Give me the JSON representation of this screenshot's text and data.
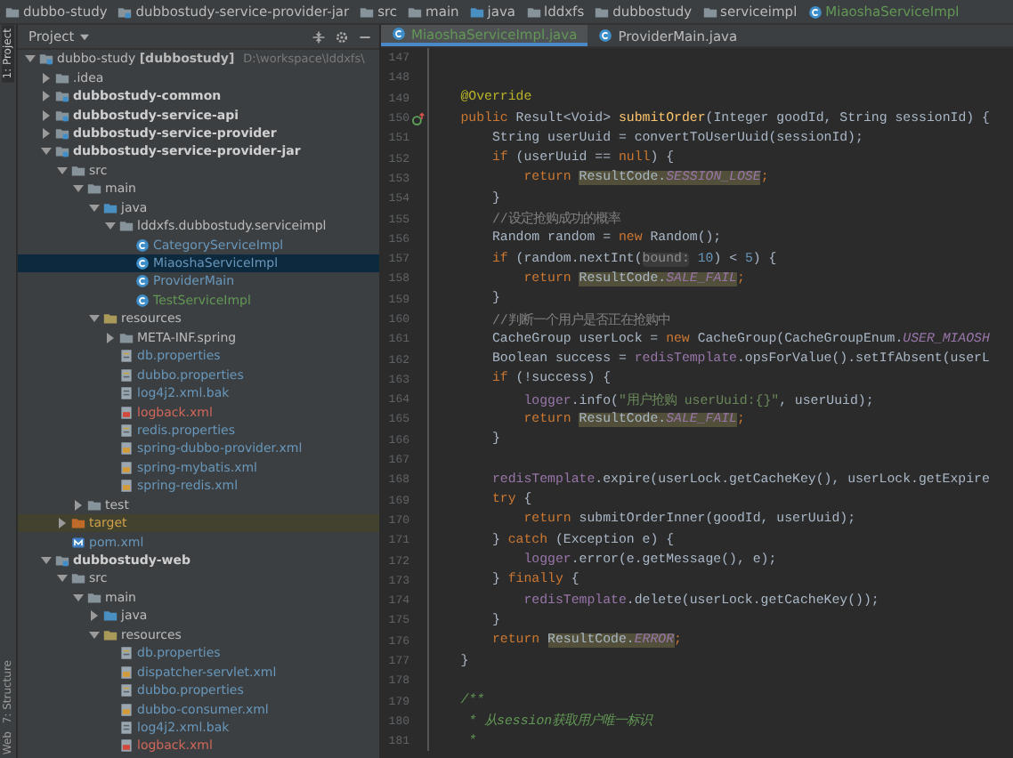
{
  "breadcrumbs": [
    {
      "label": "dubbo-study",
      "kind": "folder"
    },
    {
      "label": "dubbostudy-service-provider-jar",
      "kind": "module"
    },
    {
      "label": "src",
      "kind": "folder"
    },
    {
      "label": "main",
      "kind": "folder"
    },
    {
      "label": "java",
      "kind": "source"
    },
    {
      "label": "lddxfs",
      "kind": "folder"
    },
    {
      "label": "dubbostudy",
      "kind": "folder"
    },
    {
      "label": "serviceimpl",
      "kind": "folder"
    },
    {
      "label": "MiaoshaServiceImpl",
      "kind": "class",
      "color": "#629755"
    }
  ],
  "side_strip": [
    {
      "label": "1: Project",
      "selected": true
    },
    {
      "label": "7: Structure",
      "selected": false
    },
    {
      "label": "Web",
      "selected": false
    }
  ],
  "project_panel": {
    "title": "Project",
    "tree": [
      {
        "label": "dubbo-study **[dubbostudy]**",
        "path": "D:\\workspace\\lddxfs\\",
        "kind": "module",
        "expanded": true,
        "selected": false,
        "children": [
          {
            "label": ".idea",
            "kind": "folder",
            "expanded": false,
            "selected": false
          },
          {
            "label": "dubbostudy-common",
            "kind": "module",
            "expanded": false,
            "selected": false
          },
          {
            "label": "dubbostudy-service-api",
            "kind": "module",
            "expanded": false,
            "selected": false
          },
          {
            "label": "dubbostudy-service-provider",
            "kind": "module",
            "expanded": false,
            "selected": false
          },
          {
            "label": "dubbostudy-service-provider-jar",
            "kind": "module",
            "expanded": true,
            "selected": false,
            "children": [
              {
                "label": "src",
                "kind": "folder",
                "expanded": true,
                "selected": false,
                "children": [
                  {
                    "label": "main",
                    "kind": "folder",
                    "expanded": true,
                    "selected": false,
                    "children": [
                      {
                        "label": "java",
                        "kind": "source",
                        "expanded": true,
                        "selected": false,
                        "children": [
                          {
                            "label": "lddxfs.dubbostudy.serviceimpl",
                            "kind": "package",
                            "expanded": true,
                            "selected": false,
                            "children": [
                              {
                                "label": "CategoryServiceImpl",
                                "kind": "class",
                                "color": "#6897bb",
                                "selected": false
                              },
                              {
                                "label": "MiaoshaServiceImpl",
                                "kind": "class",
                                "color": "#6897bb",
                                "selected": true
                              },
                              {
                                "label": "ProviderMain",
                                "kind": "class",
                                "color": "#6897bb",
                                "selected": false
                              },
                              {
                                "label": "TestServiceImpl",
                                "kind": "class",
                                "color": "#629755",
                                "selected": false
                              }
                            ]
                          }
                        ]
                      },
                      {
                        "label": "resources",
                        "kind": "resources",
                        "expanded": true,
                        "selected": false,
                        "children": [
                          {
                            "label": "META-INF.spring",
                            "kind": "folder",
                            "expanded": false,
                            "selected": false
                          },
                          {
                            "label": "db.properties",
                            "kind": "properties",
                            "color": "#6897bb",
                            "selected": false
                          },
                          {
                            "label": "dubbo.properties",
                            "kind": "properties",
                            "color": "#6897bb",
                            "selected": false
                          },
                          {
                            "label": "log4j2.xml.bak",
                            "kind": "text",
                            "color": "#6897bb",
                            "selected": false
                          },
                          {
                            "label": "logback.xml",
                            "kind": "xml-red",
                            "color": "#d1675a",
                            "selected": false
                          },
                          {
                            "label": "redis.properties",
                            "kind": "properties",
                            "color": "#6897bb",
                            "selected": false
                          },
                          {
                            "label": "spring-dubbo-provider.xml",
                            "kind": "xml",
                            "color": "#6897bb",
                            "selected": false
                          },
                          {
                            "label": "spring-mybatis.xml",
                            "kind": "xml",
                            "color": "#6897bb",
                            "selected": false
                          },
                          {
                            "label": "spring-redis.xml",
                            "kind": "xml",
                            "color": "#6897bb",
                            "selected": false
                          }
                        ]
                      }
                    ]
                  },
                  {
                    "label": "test",
                    "kind": "folder",
                    "expanded": false,
                    "selected": false
                  }
                ]
              },
              {
                "label": "target",
                "kind": "excluded",
                "color": "#d0a14a",
                "expanded": false,
                "selected": false
              },
              {
                "label": "pom.xml",
                "kind": "pom",
                "color": "#6897bb",
                "selected": false
              }
            ]
          },
          {
            "label": "dubbostudy-web",
            "kind": "module",
            "expanded": true,
            "selected": false,
            "children": [
              {
                "label": "src",
                "kind": "folder",
                "expanded": true,
                "selected": false,
                "children": [
                  {
                    "label": "main",
                    "kind": "folder",
                    "expanded": true,
                    "selected": false,
                    "children": [
                      {
                        "label": "java",
                        "kind": "source",
                        "expanded": false,
                        "selected": false
                      },
                      {
                        "label": "resources",
                        "kind": "resources",
                        "expanded": true,
                        "selected": false,
                        "children": [
                          {
                            "label": "db.properties",
                            "kind": "properties",
                            "color": "#6897bb",
                            "selected": false
                          },
                          {
                            "label": "dispatcher-servlet.xml",
                            "kind": "xml",
                            "color": "#6897bb",
                            "selected": false
                          },
                          {
                            "label": "dubbo.properties",
                            "kind": "properties",
                            "color": "#6897bb",
                            "selected": false
                          },
                          {
                            "label": "dubbo-consumer.xml",
                            "kind": "xml",
                            "color": "#6897bb",
                            "selected": false
                          },
                          {
                            "label": "log4j2.xml.bak",
                            "kind": "text",
                            "color": "#6897bb",
                            "selected": false
                          },
                          {
                            "label": "logback.xml",
                            "kind": "xml-red",
                            "color": "#d1675a",
                            "selected": false
                          }
                        ]
                      }
                    ]
                  }
                ]
              }
            ]
          }
        ]
      }
    ]
  },
  "tabs": [
    {
      "label": "MiaoshaServiceImpl.java",
      "color": "#629755",
      "selected": true
    },
    {
      "label": "ProviderMain.java",
      "selected": false
    }
  ],
  "editor": {
    "lines": [
      {
        "number": "147"
      },
      {
        "number": "148"
      },
      {
        "number": "149",
        "tokens": [
          {
            "text": "    @Override",
            "kind": "annotation"
          }
        ]
      },
      {
        "number": "150",
        "overrides": true,
        "tokens": [
          {
            "text": "    public ",
            "kind": "keyword"
          },
          {
            "text": "Result<Void> ",
            "kind": "plain"
          },
          {
            "text": "submitOrder",
            "kind": "method"
          },
          {
            "text": "(Integer goodId, String sessionId) {",
            "kind": "plain"
          }
        ]
      },
      {
        "number": "151",
        "tokens": [
          {
            "text": "        String userUuid = convertToUserUuid(sessionId);",
            "kind": "plain"
          }
        ]
      },
      {
        "number": "152",
        "tokens": [
          {
            "text": "        if ",
            "kind": "keyword"
          },
          {
            "text": "(userUuid == ",
            "kind": "plain"
          },
          {
            "text": "null",
            "kind": "keyword"
          },
          {
            "text": ") {",
            "kind": "plain"
          }
        ]
      },
      {
        "number": "153",
        "tokens": [
          {
            "text": "            return ",
            "kind": "keyword"
          },
          {
            "text": "ResultCode.",
            "kind": "match"
          },
          {
            "text": "SESSION_LOSE",
            "kind": "match-static"
          },
          {
            "text": ";",
            "kind": "keyword"
          }
        ]
      },
      {
        "number": "154",
        "tokens": [
          {
            "text": "        }",
            "kind": "plain"
          }
        ]
      },
      {
        "number": "155",
        "tokens": [
          {
            "text": "        //设定抢购成功的概率",
            "kind": "comment"
          }
        ]
      },
      {
        "number": "156",
        "tokens": [
          {
            "text": "        Random random = ",
            "kind": "plain"
          },
          {
            "text": "new ",
            "kind": "keyword"
          },
          {
            "text": "Random();",
            "kind": "plain"
          }
        ]
      },
      {
        "number": "157",
        "tokens": [
          {
            "text": "        if ",
            "kind": "keyword"
          },
          {
            "text": "(random.nextInt(",
            "kind": "plain"
          },
          {
            "text": "bound:",
            "kind": "hint"
          },
          {
            "text": " 10",
            "kind": "number"
          },
          {
            "text": ") < ",
            "kind": "plain"
          },
          {
            "text": "5",
            "kind": "number"
          },
          {
            "text": ") {",
            "kind": "plain"
          }
        ]
      },
      {
        "number": "158",
        "tokens": [
          {
            "text": "            return ",
            "kind": "keyword"
          },
          {
            "text": "ResultCode.",
            "kind": "match"
          },
          {
            "text": "SALE_FAIL",
            "kind": "match-static"
          },
          {
            "text": ";",
            "kind": "keyword"
          }
        ]
      },
      {
        "number": "159",
        "tokens": [
          {
            "text": "        }",
            "kind": "plain"
          }
        ]
      },
      {
        "number": "160",
        "tokens": [
          {
            "text": "        //判断一个用户是否正在抢购中",
            "kind": "comment"
          }
        ]
      },
      {
        "number": "161",
        "tokens": [
          {
            "text": "        CacheGroup userLock = ",
            "kind": "plain"
          },
          {
            "text": "new ",
            "kind": "keyword"
          },
          {
            "text": "CacheGroup(CacheGroupEnum.",
            "kind": "plain"
          },
          {
            "text": "USER_MIAOSH",
            "kind": "static"
          }
        ]
      },
      {
        "number": "162",
        "tokens": [
          {
            "text": "        Boolean success = ",
            "kind": "plain"
          },
          {
            "text": "redisTemplate",
            "kind": "field"
          },
          {
            "text": ".opsForValue().setIfAbsent(userL",
            "kind": "plain"
          }
        ]
      },
      {
        "number": "163",
        "tokens": [
          {
            "text": "        if ",
            "kind": "keyword"
          },
          {
            "text": "(!success) {",
            "kind": "plain"
          }
        ]
      },
      {
        "number": "164",
        "tokens": [
          {
            "text": "            logger",
            "kind": "field"
          },
          {
            "text": ".info(",
            "kind": "plain"
          },
          {
            "text": "\"用户抢购 userUuid:{}\"",
            "kind": "string"
          },
          {
            "text": ", userUuid);",
            "kind": "plain"
          }
        ]
      },
      {
        "number": "165",
        "tokens": [
          {
            "text": "            return ",
            "kind": "keyword"
          },
          {
            "text": "ResultCode.",
            "kind": "match"
          },
          {
            "text": "SALE_FAIL",
            "kind": "match-static"
          },
          {
            "text": ";",
            "kind": "keyword"
          }
        ]
      },
      {
        "number": "166",
        "tokens": [
          {
            "text": "        }",
            "kind": "plain"
          }
        ]
      },
      {
        "number": "167"
      },
      {
        "number": "168",
        "tokens": [
          {
            "text": "        redisTemplate",
            "kind": "field"
          },
          {
            "text": ".expire(userLock.getCacheKey(), userLock.getExpire",
            "kind": "plain"
          }
        ]
      },
      {
        "number": "169",
        "tokens": [
          {
            "text": "        try ",
            "kind": "keyword"
          },
          {
            "text": "{",
            "kind": "plain"
          }
        ]
      },
      {
        "number": "170",
        "tokens": [
          {
            "text": "            return ",
            "kind": "keyword"
          },
          {
            "text": "submitOrderInner(goodId, userUuid);",
            "kind": "plain"
          }
        ]
      },
      {
        "number": "171",
        "tokens": [
          {
            "text": "        } ",
            "kind": "plain"
          },
          {
            "text": "catch ",
            "kind": "keyword"
          },
          {
            "text": "(Exception e) {",
            "kind": "plain"
          }
        ]
      },
      {
        "number": "172",
        "tokens": [
          {
            "text": "            logger",
            "kind": "field"
          },
          {
            "text": ".error(e.getMessage(), e);",
            "kind": "plain"
          }
        ]
      },
      {
        "number": "173",
        "tokens": [
          {
            "text": "        } ",
            "kind": "plain"
          },
          {
            "text": "finally ",
            "kind": "keyword"
          },
          {
            "text": "{",
            "kind": "plain"
          }
        ]
      },
      {
        "number": "174",
        "tokens": [
          {
            "text": "            redisTemplate",
            "kind": "field"
          },
          {
            "text": ".delete(userLock.getCacheKey());",
            "kind": "plain"
          }
        ]
      },
      {
        "number": "175",
        "tokens": [
          {
            "text": "        }",
            "kind": "plain"
          }
        ]
      },
      {
        "number": "176",
        "tokens": [
          {
            "text": "        return ",
            "kind": "keyword"
          },
          {
            "text": "ResultCode.",
            "kind": "match"
          },
          {
            "text": "ERROR",
            "kind": "match-static"
          },
          {
            "text": ";",
            "kind": "keyword"
          }
        ]
      },
      {
        "number": "177",
        "tokens": [
          {
            "text": "    }",
            "kind": "plain"
          }
        ]
      },
      {
        "number": "178"
      },
      {
        "number": "179",
        "tokens": [
          {
            "text": "    /**",
            "kind": "doc"
          }
        ]
      },
      {
        "number": "180",
        "tokens": [
          {
            "text": "     * 从session获取用户唯一标识",
            "kind": "doc"
          }
        ]
      },
      {
        "number": "181",
        "tokens": [
          {
            "text": "     *",
            "kind": "doc"
          }
        ]
      }
    ]
  }
}
